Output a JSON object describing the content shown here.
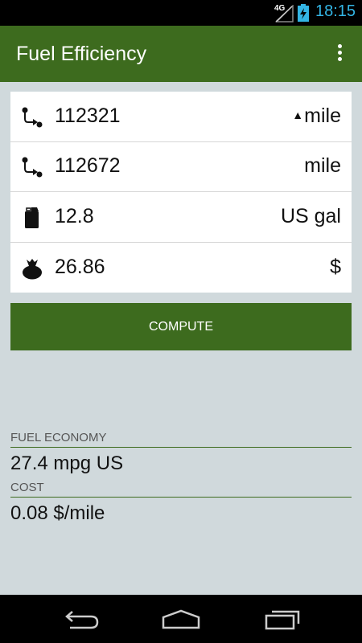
{
  "status": {
    "network": "4G",
    "time": "18:15"
  },
  "app": {
    "title": "Fuel Efficiency"
  },
  "inputs": [
    {
      "icon": "odometer-start-icon",
      "value": "112321",
      "unit": "mile",
      "unit_marker": "▲"
    },
    {
      "icon": "odometer-end-icon",
      "value": "112672",
      "unit": "mile"
    },
    {
      "icon": "fuel-can-icon",
      "value": "12.8",
      "unit": "US gal"
    },
    {
      "icon": "money-bag-icon",
      "value": "26.86",
      "unit": "$"
    }
  ],
  "compute_label": "COMPUTE",
  "results": [
    {
      "label": "FUEL ECONOMY",
      "value": "27.4 mpg US"
    },
    {
      "label": "COST",
      "value": "0.08 $/mile"
    }
  ],
  "colors": {
    "primary": "#3d6b1e",
    "background": "#d0d9dc",
    "clock": "#33b5e5"
  }
}
